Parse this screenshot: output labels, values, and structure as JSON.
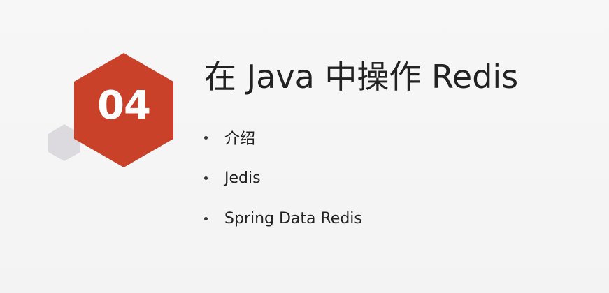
{
  "slide": {
    "section_number": "04",
    "title": "在 Java 中操作 Redis",
    "bullets": [
      {
        "label": "介绍"
      },
      {
        "label": "Jedis"
      },
      {
        "label": "Spring Data Redis"
      }
    ]
  },
  "colors": {
    "accent": "#c94129",
    "secondary_hex": "#dcdadf",
    "background": "#f5f5f5",
    "text": "#222222"
  }
}
